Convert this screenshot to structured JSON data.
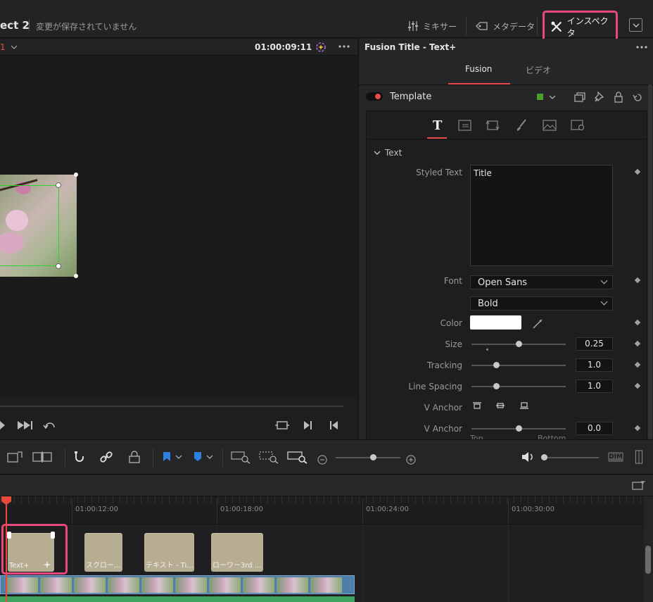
{
  "project": {
    "name": "ect 2",
    "status": "変更が保存されていません"
  },
  "topbar": {
    "mixer_label": "ミキサー",
    "metadata_label": "メタデータ",
    "inspector_label": "インスペクタ"
  },
  "viewer": {
    "track_label": "1",
    "timecode": "01:00:09:11"
  },
  "inspector": {
    "title": "Fusion Title - Text+",
    "tabs": [
      "Fusion",
      "ビデオ"
    ],
    "template_label": "Template",
    "section": "Text",
    "styled_text_label": "Styled Text",
    "styled_text_value": "Title",
    "font_label": "Font",
    "font_value": "Open Sans",
    "style_value": "Bold",
    "color_label": "Color",
    "size_label": "Size",
    "size_value": "0.25",
    "tracking_label": "Tracking",
    "tracking_value": "1.0",
    "line_spacing_label": "Line Spacing",
    "line_spacing_value": "1.0",
    "vanchor_label": "V Anchor",
    "vanchor2_label": "V Anchor",
    "vanchor2_value": "0.0",
    "partial_top": "Top",
    "partial_bottom": "Bottom"
  },
  "toolbar": {
    "dim_label": "DIM"
  },
  "timeline": {
    "ruler": [
      "01:00:12:00",
      "01:00:18:00",
      "01:00:24:00",
      "01:00:30:00"
    ],
    "clips": [
      "Text+",
      "スクロー...",
      "テキスト - Ti...",
      "ローワー3rd ..."
    ]
  },
  "colors": {
    "accent": "#e84a7f",
    "playhead": "#e84a3a",
    "video_track": "#4d7fa8",
    "audio_track": "#3fa25d"
  }
}
